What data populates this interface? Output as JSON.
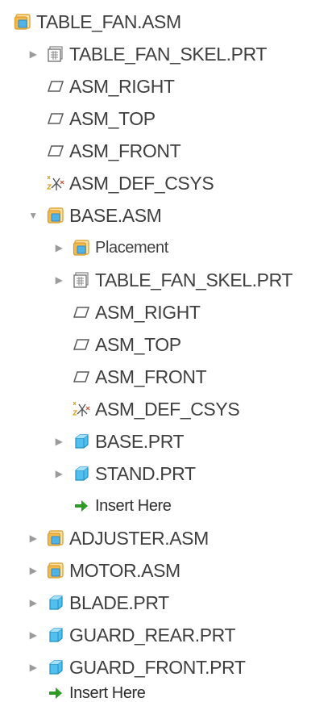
{
  "colors": {
    "text": "#3f3f3f",
    "expander": "#9b9b9b",
    "assembly_icon": "#f0b84a",
    "part_icon": "#1ea3d6",
    "insert_arrow": "#2e9b24"
  },
  "tree": {
    "root": {
      "label": "TABLE_FAN.ASM",
      "icon": "assembly-icon"
    },
    "items": [
      {
        "label": "TABLE_FAN_SKEL.PRT",
        "icon": "skeleton-icon",
        "expander": "collapsed"
      },
      {
        "label": "ASM_RIGHT",
        "icon": "datum-plane-icon"
      },
      {
        "label": "ASM_TOP",
        "icon": "datum-plane-icon"
      },
      {
        "label": "ASM_FRONT",
        "icon": "datum-plane-icon"
      },
      {
        "label": "ASM_DEF_CSYS",
        "icon": "csys-icon"
      },
      {
        "label": "BASE.ASM",
        "icon": "assembly-icon",
        "expander": "expanded"
      },
      {
        "label": "Placement",
        "icon": "placement-icon",
        "expander": "collapsed"
      },
      {
        "label": "TABLE_FAN_SKEL.PRT",
        "icon": "skeleton-icon",
        "expander": "collapsed"
      },
      {
        "label": "ASM_RIGHT",
        "icon": "datum-plane-icon"
      },
      {
        "label": "ASM_TOP",
        "icon": "datum-plane-icon"
      },
      {
        "label": "ASM_FRONT",
        "icon": "datum-plane-icon"
      },
      {
        "label": "ASM_DEF_CSYS",
        "icon": "csys-icon"
      },
      {
        "label": "BASE.PRT",
        "icon": "part-icon",
        "expander": "collapsed"
      },
      {
        "label": "STAND.PRT",
        "icon": "part-icon",
        "expander": "collapsed"
      },
      {
        "label": "Insert Here",
        "icon": "insert-arrow-icon"
      },
      {
        "label": "ADJUSTER.ASM",
        "icon": "assembly-icon",
        "expander": "collapsed"
      },
      {
        "label": "MOTOR.ASM",
        "icon": "assembly-icon",
        "expander": "collapsed"
      },
      {
        "label": "BLADE.PRT",
        "icon": "part-icon",
        "expander": "collapsed"
      },
      {
        "label": "GUARD_REAR.PRT",
        "icon": "part-icon",
        "expander": "collapsed"
      },
      {
        "label": "GUARD_FRONT.PRT",
        "icon": "part-icon",
        "expander": "collapsed"
      },
      {
        "label": "Insert Here",
        "icon": "insert-arrow-icon"
      }
    ]
  }
}
